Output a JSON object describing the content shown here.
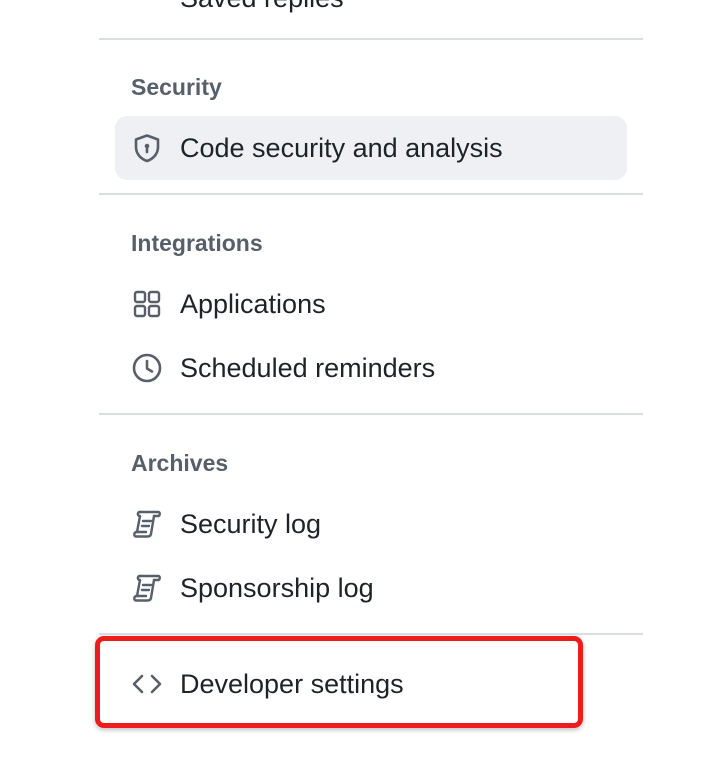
{
  "nav": {
    "partial_item": {
      "label": "Saved replies",
      "icon": "reply-icon"
    },
    "sections": [
      {
        "heading": "Security",
        "items": [
          {
            "label": "Code security and analysis",
            "icon": "shield-lock-icon",
            "selected": true
          }
        ]
      },
      {
        "heading": "Integrations",
        "items": [
          {
            "label": "Applications",
            "icon": "apps-icon",
            "selected": false
          },
          {
            "label": "Scheduled reminders",
            "icon": "clock-icon",
            "selected": false
          }
        ]
      },
      {
        "heading": "Archives",
        "items": [
          {
            "label": "Security log",
            "icon": "log-icon",
            "selected": false
          },
          {
            "label": "Sponsorship log",
            "icon": "log-icon",
            "selected": false
          }
        ]
      }
    ],
    "developer_settings": {
      "label": "Developer settings",
      "icon": "code-icon"
    }
  },
  "colors": {
    "text": "#1f2328",
    "heading": "#57606a",
    "divider": "#d8dee4",
    "selected_bg": "#eef0f3",
    "annotation": "#ee1c1c"
  }
}
